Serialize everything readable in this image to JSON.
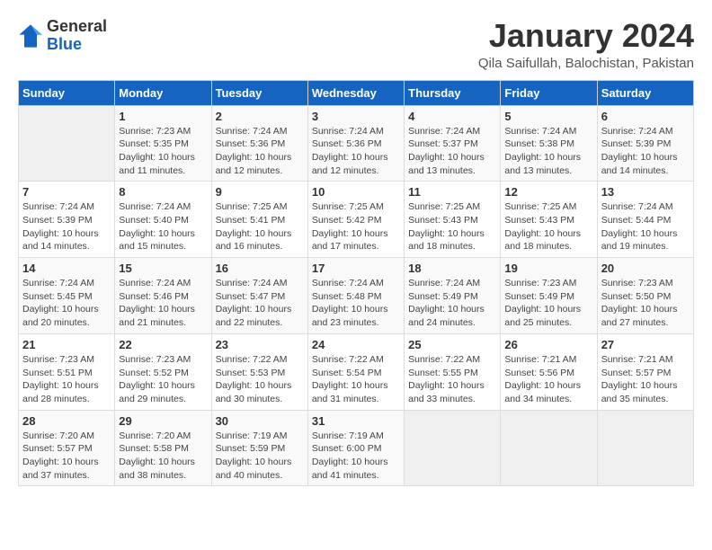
{
  "header": {
    "logo_general": "General",
    "logo_blue": "Blue",
    "month_title": "January 2024",
    "location": "Qila Saifullah, Balochistan, Pakistan"
  },
  "days_of_week": [
    "Sunday",
    "Monday",
    "Tuesday",
    "Wednesday",
    "Thursday",
    "Friday",
    "Saturday"
  ],
  "weeks": [
    [
      {
        "day": "",
        "info": ""
      },
      {
        "day": "1",
        "info": "Sunrise: 7:23 AM\nSunset: 5:35 PM\nDaylight: 10 hours\nand 11 minutes."
      },
      {
        "day": "2",
        "info": "Sunrise: 7:24 AM\nSunset: 5:36 PM\nDaylight: 10 hours\nand 12 minutes."
      },
      {
        "day": "3",
        "info": "Sunrise: 7:24 AM\nSunset: 5:36 PM\nDaylight: 10 hours\nand 12 minutes."
      },
      {
        "day": "4",
        "info": "Sunrise: 7:24 AM\nSunset: 5:37 PM\nDaylight: 10 hours\nand 13 minutes."
      },
      {
        "day": "5",
        "info": "Sunrise: 7:24 AM\nSunset: 5:38 PM\nDaylight: 10 hours\nand 13 minutes."
      },
      {
        "day": "6",
        "info": "Sunrise: 7:24 AM\nSunset: 5:39 PM\nDaylight: 10 hours\nand 14 minutes."
      }
    ],
    [
      {
        "day": "7",
        "info": "Sunrise: 7:24 AM\nSunset: 5:39 PM\nDaylight: 10 hours\nand 14 minutes."
      },
      {
        "day": "8",
        "info": "Sunrise: 7:24 AM\nSunset: 5:40 PM\nDaylight: 10 hours\nand 15 minutes."
      },
      {
        "day": "9",
        "info": "Sunrise: 7:25 AM\nSunset: 5:41 PM\nDaylight: 10 hours\nand 16 minutes."
      },
      {
        "day": "10",
        "info": "Sunrise: 7:25 AM\nSunset: 5:42 PM\nDaylight: 10 hours\nand 17 minutes."
      },
      {
        "day": "11",
        "info": "Sunrise: 7:25 AM\nSunset: 5:43 PM\nDaylight: 10 hours\nand 18 minutes."
      },
      {
        "day": "12",
        "info": "Sunrise: 7:25 AM\nSunset: 5:43 PM\nDaylight: 10 hours\nand 18 minutes."
      },
      {
        "day": "13",
        "info": "Sunrise: 7:24 AM\nSunset: 5:44 PM\nDaylight: 10 hours\nand 19 minutes."
      }
    ],
    [
      {
        "day": "14",
        "info": "Sunrise: 7:24 AM\nSunset: 5:45 PM\nDaylight: 10 hours\nand 20 minutes."
      },
      {
        "day": "15",
        "info": "Sunrise: 7:24 AM\nSunset: 5:46 PM\nDaylight: 10 hours\nand 21 minutes."
      },
      {
        "day": "16",
        "info": "Sunrise: 7:24 AM\nSunset: 5:47 PM\nDaylight: 10 hours\nand 22 minutes."
      },
      {
        "day": "17",
        "info": "Sunrise: 7:24 AM\nSunset: 5:48 PM\nDaylight: 10 hours\nand 23 minutes."
      },
      {
        "day": "18",
        "info": "Sunrise: 7:24 AM\nSunset: 5:49 PM\nDaylight: 10 hours\nand 24 minutes."
      },
      {
        "day": "19",
        "info": "Sunrise: 7:23 AM\nSunset: 5:49 PM\nDaylight: 10 hours\nand 25 minutes."
      },
      {
        "day": "20",
        "info": "Sunrise: 7:23 AM\nSunset: 5:50 PM\nDaylight: 10 hours\nand 27 minutes."
      }
    ],
    [
      {
        "day": "21",
        "info": "Sunrise: 7:23 AM\nSunset: 5:51 PM\nDaylight: 10 hours\nand 28 minutes."
      },
      {
        "day": "22",
        "info": "Sunrise: 7:23 AM\nSunset: 5:52 PM\nDaylight: 10 hours\nand 29 minutes."
      },
      {
        "day": "23",
        "info": "Sunrise: 7:22 AM\nSunset: 5:53 PM\nDaylight: 10 hours\nand 30 minutes."
      },
      {
        "day": "24",
        "info": "Sunrise: 7:22 AM\nSunset: 5:54 PM\nDaylight: 10 hours\nand 31 minutes."
      },
      {
        "day": "25",
        "info": "Sunrise: 7:22 AM\nSunset: 5:55 PM\nDaylight: 10 hours\nand 33 minutes."
      },
      {
        "day": "26",
        "info": "Sunrise: 7:21 AM\nSunset: 5:56 PM\nDaylight: 10 hours\nand 34 minutes."
      },
      {
        "day": "27",
        "info": "Sunrise: 7:21 AM\nSunset: 5:57 PM\nDaylight: 10 hours\nand 35 minutes."
      }
    ],
    [
      {
        "day": "28",
        "info": "Sunrise: 7:20 AM\nSunset: 5:57 PM\nDaylight: 10 hours\nand 37 minutes."
      },
      {
        "day": "29",
        "info": "Sunrise: 7:20 AM\nSunset: 5:58 PM\nDaylight: 10 hours\nand 38 minutes."
      },
      {
        "day": "30",
        "info": "Sunrise: 7:19 AM\nSunset: 5:59 PM\nDaylight: 10 hours\nand 40 minutes."
      },
      {
        "day": "31",
        "info": "Sunrise: 7:19 AM\nSunset: 6:00 PM\nDaylight: 10 hours\nand 41 minutes."
      },
      {
        "day": "",
        "info": ""
      },
      {
        "day": "",
        "info": ""
      },
      {
        "day": "",
        "info": ""
      }
    ]
  ]
}
